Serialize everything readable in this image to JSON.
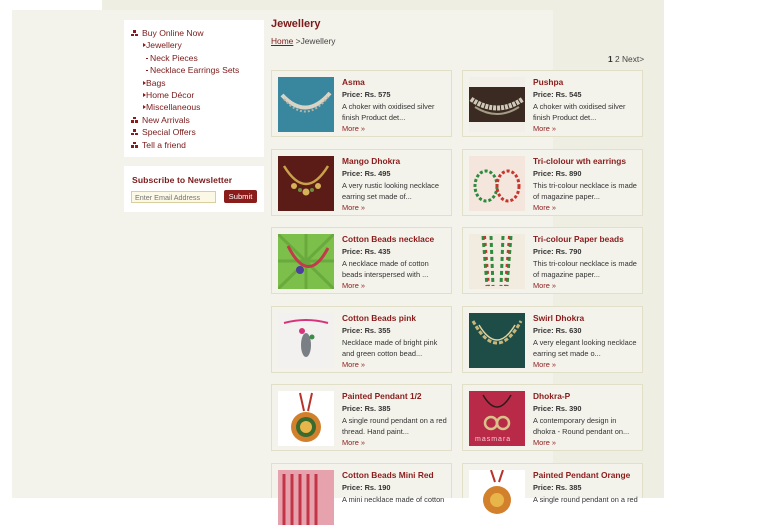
{
  "sidebar": {
    "categories": [
      {
        "label": "Buy Online Now",
        "level": 1,
        "icon": "triangle-bullet-icon"
      },
      {
        "label": "Jewellery",
        "level": 3,
        "icon": "arrow-right-icon"
      },
      {
        "label": "Neck Pieces",
        "level": 2,
        "icon": "dash-icon"
      },
      {
        "label": "Necklace Earrings Sets",
        "level": 2,
        "icon": "dash-icon"
      },
      {
        "label": "Bags",
        "level": 3,
        "icon": "arrow-right-icon"
      },
      {
        "label": "Home Décor",
        "level": 3,
        "icon": "arrow-right-icon"
      },
      {
        "label": "Miscellaneous",
        "level": 3,
        "icon": "arrow-right-icon"
      },
      {
        "label": "New Arrivals",
        "level": 1,
        "icon": "triangle-bullet-icon"
      },
      {
        "label": "Special Offers",
        "level": 1,
        "icon": "triangle-bullet-icon"
      },
      {
        "label": "Tell a friend",
        "level": 1,
        "icon": "triangle-bullet-icon"
      }
    ],
    "newsletter": {
      "title": "Subscribe to Newsletter",
      "placeholder": "Enter Email Address",
      "submit_label": "Submit"
    }
  },
  "main": {
    "title": "Jewellery",
    "breadcrumb": {
      "home": "Home",
      "separator": " >",
      "current": "Jewellery"
    },
    "pager": {
      "current": "1",
      "next_page": "2",
      "next_label": "Next>"
    },
    "products": [
      {
        "name": "Asma",
        "price": "Price: Rs. 575",
        "desc": "A choker with oxidised silver finish Product det...",
        "more": "More »"
      },
      {
        "name": "Pushpa",
        "price": "Price: Rs. 545",
        "desc": "A choker with oxidised silver finish Product det...",
        "more": "More »"
      },
      {
        "name": "Mango Dhokra",
        "price": "Price: Rs. 495",
        "desc": "A very rustic looking necklace earring set made of...",
        "more": "More »"
      },
      {
        "name": "Tri-clolour wth earrings",
        "price": "Price: Rs. 890",
        "desc": "This tri-colour necklace is made of magazine paper...",
        "more": "More »"
      },
      {
        "name": "Cotton Beads necklace",
        "price": "Price: Rs. 435",
        "desc": "A necklace made of cotton beads interspersed with ...",
        "more": "More »"
      },
      {
        "name": "Tri-colour Paper beads",
        "price": "Price: Rs. 790",
        "desc": "This tri-colour necklace is made of magazine paper...",
        "more": "More »"
      },
      {
        "name": "Cotton Beads pink",
        "price": "Price: Rs. 355",
        "desc": "Necklace made of bright pink and green cotton bead...",
        "more": "More »"
      },
      {
        "name": "Swirl Dhokra",
        "price": "Price: Rs. 630",
        "desc": "A very elegant looking necklace earring set made o...",
        "more": "More »"
      },
      {
        "name": "Painted Pendant 1/2",
        "price": "Price: Rs. 385",
        "desc": "A single round pendant on a red thread. Hand paint...",
        "more": "More »"
      },
      {
        "name": "Dhokra-P",
        "price": "Price: Rs. 390",
        "desc": "A contemporary design in dhokra - Round pendant on...",
        "more": "More »"
      },
      {
        "name": "Cotton Beads Mini Red",
        "price": "Price: Rs. 190",
        "desc": "A mini necklace made of cotton",
        "more": ""
      },
      {
        "name": "Painted Pendant Orange",
        "price": "Price: Rs. 385",
        "desc": "A single round pendant on a red",
        "more": ""
      }
    ],
    "image_watermark": "masmara"
  },
  "colors": {
    "accent": "#8a1c1c",
    "page_bg": "#eeeee3",
    "card_bg": "#f4f3eb",
    "card_border": "#e2dfc9"
  }
}
